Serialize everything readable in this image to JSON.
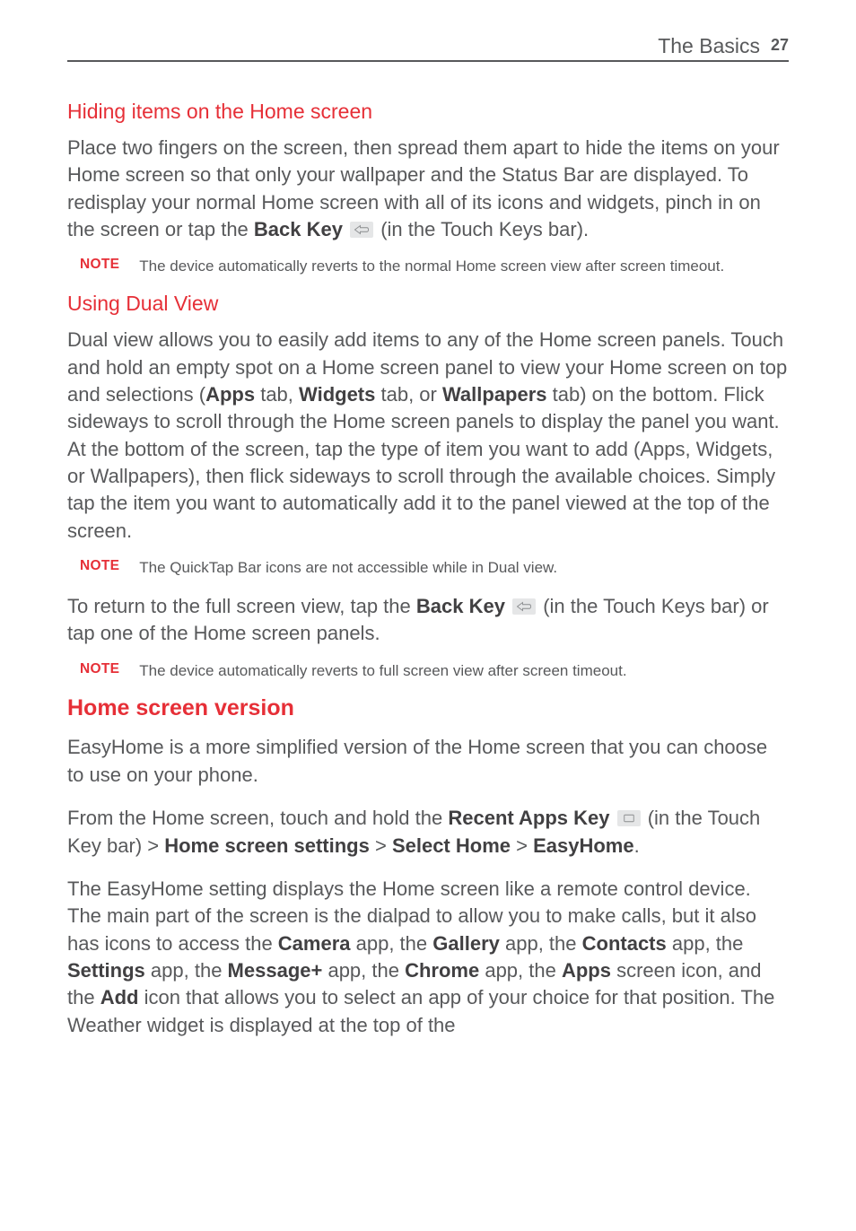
{
  "header": {
    "section": "The Basics",
    "page": "27"
  },
  "s1": {
    "heading": "Hiding items on the Home screen",
    "p1a": "Place two fingers on the screen, then spread them apart to hide the items on your Home screen so that only your wallpaper and the Status Bar are displayed. To redisplay your normal Home screen with all of its icons and widgets, pinch in on the screen or tap the ",
    "p1b": "Back Key",
    "p1c": " (in the Touch Keys bar).",
    "noteLabel": "NOTE",
    "noteText": "The device automatically reverts to the normal Home screen view after screen timeout."
  },
  "s2": {
    "heading": "Using Dual View",
    "p1a": "Dual view allows you to easily add items to any of the Home screen panels. Touch and hold an empty spot on a Home screen panel to view your Home screen on top and selections (",
    "p1b": "Apps",
    "p1c": " tab, ",
    "p1d": "Widgets",
    "p1e": " tab, or ",
    "p1f": "Wallpapers",
    "p1g": " tab) on the bottom. Flick sideways to scroll through the Home screen panels to display the panel you want. At the bottom of the screen, tap the type of item you want to add (Apps, Widgets, or Wallpapers), then flick sideways to scroll through the available choices. Simply tap the item you want to automatically add it to the panel viewed at the top of the screen.",
    "note1Label": "NOTE",
    "note1Text": "The QuickTap Bar icons are not accessible while in Dual view.",
    "p2a": "To return to the full screen view, tap the ",
    "p2b": "Back Key",
    "p2c": " (in the Touch Keys bar) or tap one of the Home screen panels.",
    "note2Label": "NOTE",
    "note2Text": "The device automatically reverts to full screen view after screen timeout."
  },
  "s3": {
    "heading": "Home screen version",
    "p1": "EasyHome is a more simplified version of the Home screen that you can choose to use on your phone.",
    "p2a": "From the Home screen, touch and hold the ",
    "p2b": "Recent Apps Key",
    "p2c": " (in the Touch Key bar) > ",
    "p2d": "Home screen settings",
    "p2e": " > ",
    "p2f": "Select Home",
    "p2g": " > ",
    "p2h": "EasyHome",
    "p2i": ".",
    "p3a": "The EasyHome setting displays the Home screen like a remote control device. The main part of the screen is the dialpad to allow you to make calls, but it also has icons to access the ",
    "p3b": "Camera",
    "p3c": " app, the ",
    "p3d": "Gallery",
    "p3e": " app, the ",
    "p3f": "Contacts",
    "p3g": " app, the ",
    "p3h": "Settings",
    "p3i": " app, the ",
    "p3j": "Message+",
    "p3k": " app, the ",
    "p3l": "Chrome",
    "p3m": " app, the ",
    "p3n": "Apps",
    "p3o": " screen icon, and the ",
    "p3p": "Add",
    "p3q": " icon that allows you to select an app of your choice for that position. The Weather widget is displayed at the top of the "
  }
}
